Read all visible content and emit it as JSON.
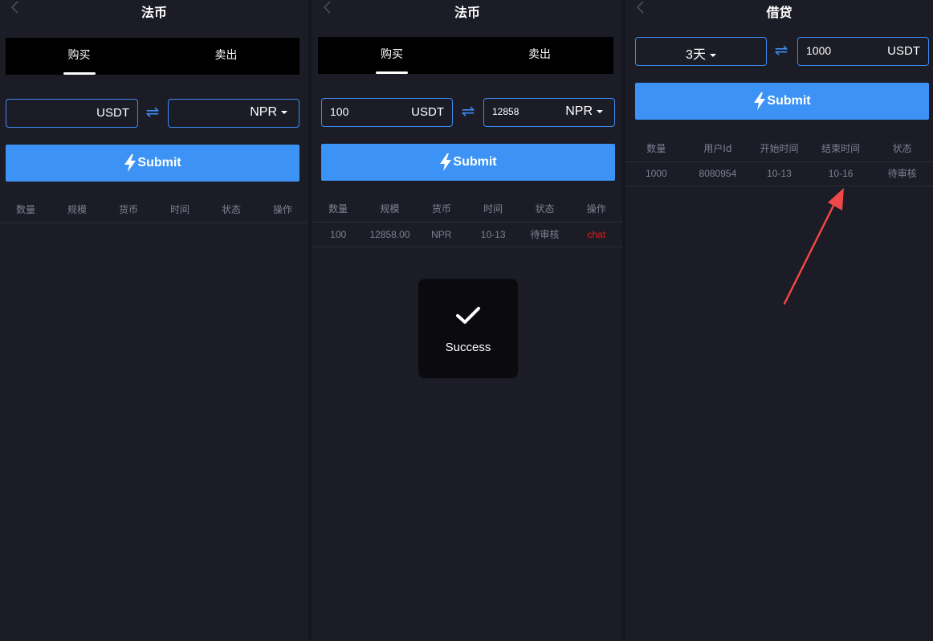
{
  "colors": {
    "background": "#1b1c26",
    "accent": "#3d93f5",
    "tab_bar": "#000000",
    "muted_text": "#7f8293",
    "chat_link": "#e51c1c",
    "annotation_arrow": "#ef4848"
  },
  "screen1": {
    "title": "法币",
    "tabs": [
      {
        "label": "购买",
        "active": true
      },
      {
        "label": "卖出",
        "active": false
      }
    ],
    "amount_value": "",
    "amount_unit": "USDT",
    "fiat_value": "",
    "fiat_currency": "NPR",
    "submit_label": "Submit",
    "table": {
      "headers": [
        "数量",
        "规模",
        "货币",
        "时间",
        "状态",
        "操作"
      ],
      "rows": []
    }
  },
  "screen2": {
    "title": "法币",
    "tabs": [
      {
        "label": "购买",
        "active": true
      },
      {
        "label": "卖出",
        "active": false
      }
    ],
    "amount_value": "100",
    "amount_unit": "USDT",
    "fiat_value": "12858",
    "fiat_currency": "NPR",
    "submit_label": "Submit",
    "table": {
      "headers": [
        "数量",
        "规模",
        "货币",
        "时间",
        "状态",
        "操作"
      ],
      "rows": [
        [
          "100",
          "12858.00",
          "NPR",
          "10-13",
          "待审核",
          "chat"
        ]
      ]
    },
    "toast": {
      "text": "Success",
      "icon": "check-icon"
    }
  },
  "screen3": {
    "title": "借贷",
    "period_value": "3天",
    "amount_value": "1000",
    "amount_unit": "USDT",
    "submit_label": "Submit",
    "table": {
      "headers": [
        "数量",
        "用户Id",
        "开始时间",
        "结束时间",
        "状态"
      ],
      "rows": [
        [
          "1000",
          "8080954",
          "10-13",
          "10-16",
          "待审核"
        ]
      ]
    }
  }
}
